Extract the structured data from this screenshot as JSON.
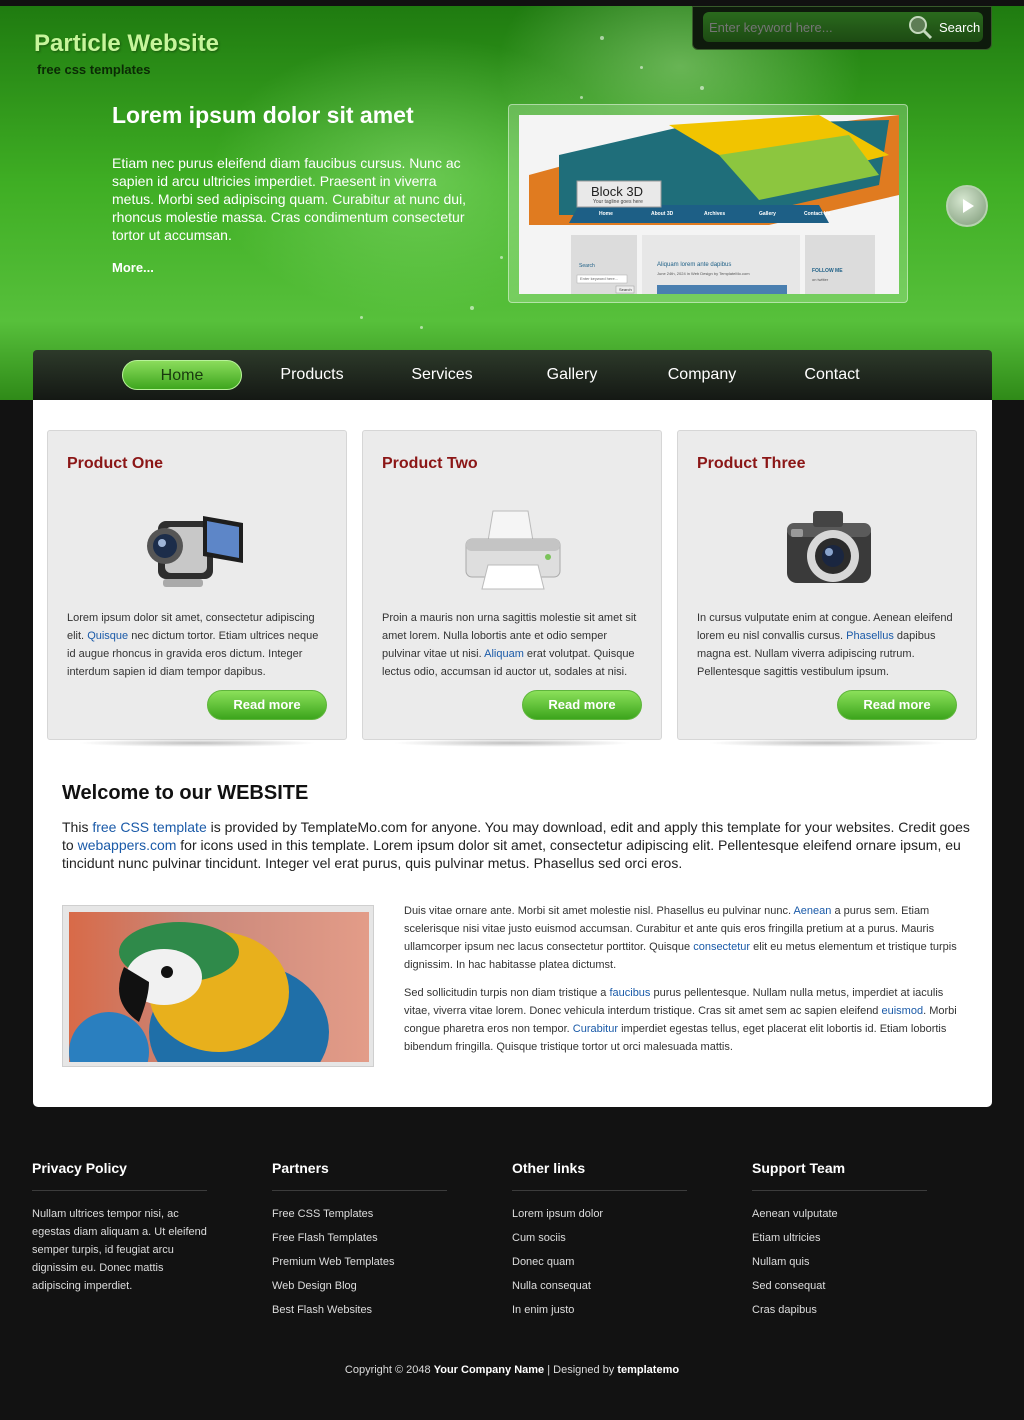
{
  "site": {
    "title": "Particle Website",
    "subtitle": "free css templates"
  },
  "search": {
    "placeholder": "Enter keyword here...",
    "button_label": "Search"
  },
  "hero": {
    "title": "Lorem ipsum dolor sit amet",
    "text": "Etiam nec purus eleifend diam faucibus cursus. Nunc ac sapien id arcu ultricies imperdiet. Praesent in viverra metus. Morbi sed adipiscing quam. Curabitur at nunc dui, rhoncus molestie massa. Cras condimentum consectetur tortor ut accumsan.",
    "more_label": "More...",
    "image": {
      "block_label": "Block 3D",
      "tagline": "Your tagline goes here",
      "nav": [
        "Home",
        "About 3D",
        "Archives",
        "Gallery",
        "Contact Us"
      ],
      "search_label": "Search",
      "search_placeholder": "Enter keyword here...",
      "search_button": "Search",
      "post_title": "Aliquam lorem ante dapibus",
      "post_meta": "June 24th, 2024 in Web Design by TemplateMo.com",
      "follow_label": "FOLLOW ME",
      "twitter_label": "on twitter"
    }
  },
  "nav": {
    "items": [
      "Home",
      "Products",
      "Services",
      "Gallery",
      "Company",
      "Contact"
    ],
    "active": "Home"
  },
  "products": [
    {
      "title": "Product One",
      "icon": "video-camera-icon",
      "text_before": "Lorem ipsum dolor sit amet, consectetur adipiscing elit. ",
      "link": "Quisque",
      "text_after": " nec dictum tortor. Etiam ultrices neque id augue rhoncus in gravida eros dictum. Integer interdum sapien id diam tempor dapibus.",
      "button_label": "Read more"
    },
    {
      "title": "Product Two",
      "icon": "printer-icon",
      "text_before": "Proin a mauris non urna sagittis molestie sit amet sit amet lorem. Nulla lobortis ante et odio semper pulvinar vitae ut nisi. ",
      "link": "Aliquam",
      "text_after": " erat volutpat. Quisque lectus odio, accumsan id auctor ut, sodales at nisi.",
      "button_label": "Read more"
    },
    {
      "title": "Product Three",
      "icon": "camera-icon",
      "text_before": "In cursus vulputate enim at congue. Aenean eleifend lorem eu nisl convallis cursus. ",
      "link": "Phasellus",
      "text_after": " dapibus magna est. Nullam viverra adipiscing rutrum. Pellentesque sagittis vestibulum ipsum.",
      "button_label": "Read more"
    }
  ],
  "welcome": {
    "title": "Welcome to our WEBSITE",
    "text_1": "This ",
    "link_1": "free CSS template",
    "text_2": " is provided by TemplateMo.com for anyone. You may download, edit and apply this template for your websites. Credit goes to ",
    "link_2": "webappers.com",
    "text_3": " for icons used in this template. Lorem ipsum dolor sit amet, consectetur adipiscing elit. Pellentesque eleifend ornare ipsum, eu tincidunt nunc pulvinar tincidunt. Integer vel erat purus, quis pulvinar metus. Phasellus sed orci eros."
  },
  "article": {
    "p1_a": "Duis vitae ornare ante. Morbi sit amet molestie nisl. Phasellus eu pulvinar nunc. ",
    "p1_link1": "Aenean",
    "p1_b": " a purus sem. Etiam scelerisque nisi vitae justo euismod accumsan. Curabitur et ante quis eros fringilla pretium at a purus. Mauris ullamcorper ipsum nec lacus consectetur porttitor. Quisque ",
    "p1_link2": "consectetur",
    "p1_c": " elit eu metus elementum et tristique turpis dignissim. In hac habitasse platea dictumst.",
    "p2_a": "Sed sollicitudin turpis non diam tristique a ",
    "p2_link1": "faucibus",
    "p2_b": " purus pellentesque. Nullam nulla metus, imperdiet at iaculis vitae, viverra vitae lorem. Donec vehicula interdum tristique. Cras sit amet sem ac sapien eleifend ",
    "p2_link2": "euismod",
    "p2_c": ". Morbi congue pharetra eros non tempor. ",
    "p2_link3": "Curabitur",
    "p2_d": " imperdiet egestas tellus, eget placerat elit lobortis id. Etiam lobortis bibendum fringilla. Quisque tristique tortor ut orci malesuada mattis."
  },
  "footer": {
    "privacy": {
      "title": "Privacy Policy",
      "text": "Nullam ultrices tempor nisi, ac egestas diam aliquam a. Ut eleifend semper turpis, id feugiat arcu dignissim eu. Donec mattis adipiscing imperdiet."
    },
    "partners": {
      "title": "Partners",
      "links": [
        "Free CSS Templates",
        "Free Flash Templates",
        "Premium Web Templates",
        "Web Design Blog",
        "Best Flash Websites"
      ]
    },
    "other": {
      "title": "Other links",
      "links": [
        "Lorem ipsum dolor",
        "Cum sociis",
        "Donec quam",
        "Nulla consequat",
        "In enim justo"
      ]
    },
    "support": {
      "title": "Support Team",
      "links": [
        "Aenean vulputate",
        "Etiam ultricies",
        "Nullam quis",
        "Sed consequat",
        "Cras dapibus"
      ]
    },
    "copyright_prefix": "Copyright © 2048 ",
    "company": "Your Company Name",
    "designed_by": " | Designed by ",
    "designer": "templatemo"
  }
}
